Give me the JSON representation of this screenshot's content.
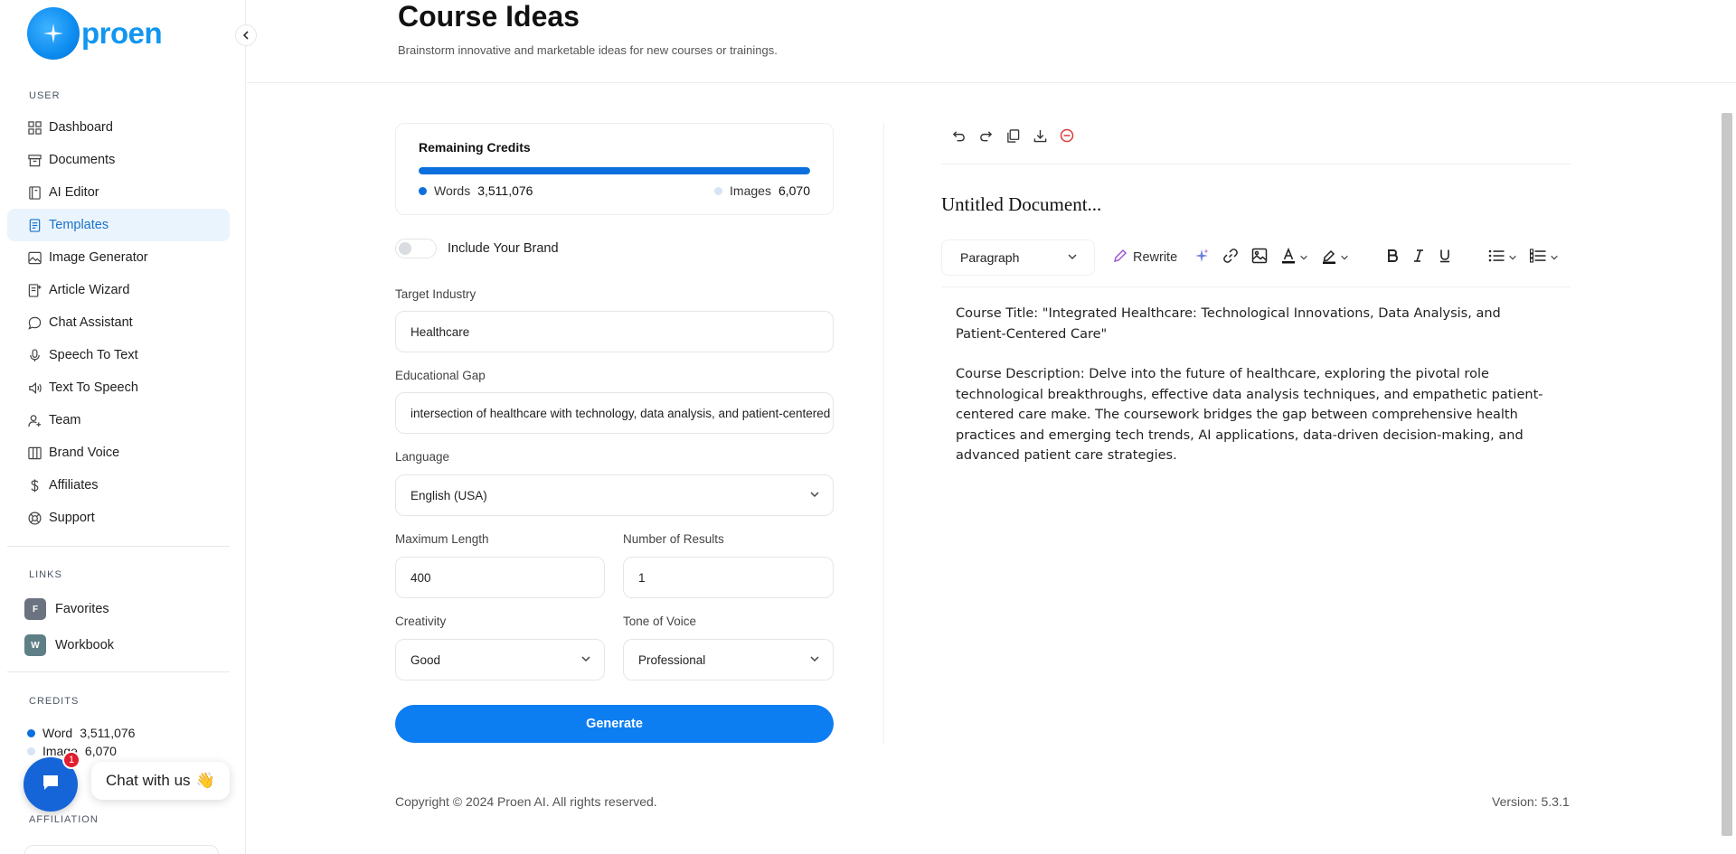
{
  "brand": {
    "name": "proen"
  },
  "sidebar": {
    "user_label": "USER",
    "items": [
      {
        "label": "Dashboard",
        "icon": "grid-icon"
      },
      {
        "label": "Documents",
        "icon": "archive-icon"
      },
      {
        "label": "AI Editor",
        "icon": "book-icon"
      },
      {
        "label": "Templates",
        "icon": "file-text-icon",
        "active": true
      },
      {
        "label": "Image Generator",
        "icon": "image-icon"
      },
      {
        "label": "Article Wizard",
        "icon": "wizard-doc-icon"
      },
      {
        "label": "Chat Assistant",
        "icon": "chat-icon"
      },
      {
        "label": "Speech To Text",
        "icon": "microphone-icon"
      },
      {
        "label": "Text To Speech",
        "icon": "speaker-icon"
      },
      {
        "label": "Team",
        "icon": "user-plus-icon"
      },
      {
        "label": "Brand Voice",
        "icon": "layout-icon"
      },
      {
        "label": "Affiliates",
        "icon": "dollar-icon"
      },
      {
        "label": "Support",
        "icon": "lifebuoy-icon"
      }
    ],
    "links_label": "LINKS",
    "links": [
      {
        "badge": "F",
        "label": "Favorites",
        "color": "#6b7280"
      },
      {
        "badge": "W",
        "label": "Workbook",
        "color": "#5f7f86"
      }
    ],
    "credits_label": "CREDITS",
    "credits": {
      "word_label": "Word",
      "word_value": "3,511,076",
      "image_label": "Image",
      "image_value": "6,070"
    },
    "affiliation_label": "AFFILIATION"
  },
  "chat": {
    "badge": "1",
    "label": "Chat with us",
    "wave": "👋"
  },
  "header": {
    "title": "Course Ideas",
    "subtitle": "Brainstorm innovative and marketable ideas for new courses or trainings."
  },
  "form": {
    "credits_title": "Remaining Credits",
    "words_label": "Words",
    "words_value": "3,511,076",
    "images_label": "Images",
    "images_value": "6,070",
    "words_progress": 1.0,
    "brand_toggle_label": "Include Your Brand",
    "target_industry_label": "Target Industry",
    "target_industry_value": "Healthcare",
    "educational_gap_label": "Educational Gap",
    "educational_gap_value": "intersection of healthcare with technology, data analysis, and patient-centered care",
    "language_label": "Language",
    "language_value": "English (USA)",
    "max_length_label": "Maximum Length",
    "max_length_value": "400",
    "num_results_label": "Number of Results",
    "num_results_value": "1",
    "creativity_label": "Creativity",
    "creativity_value": "Good",
    "tone_label": "Tone of Voice",
    "tone_value": "Professional",
    "generate_label": "Generate"
  },
  "editor": {
    "doc_title": "Untitled Document...",
    "block_type": "Paragraph",
    "rewrite_label": "Rewrite",
    "paragraphs": [
      "Course Title: \"Integrated Healthcare: Technological Innovations, Data Analysis, and Patient-Centered Care\"",
      "Course Description: Delve into the future of healthcare, exploring the pivotal role technological breakthroughs, effective data analysis techniques, and empathetic patient-centered care make. The coursework bridges the gap between comprehensive health practices and emerging tech trends, AI applications, data-driven decision-making, and advanced patient care strategies."
    ]
  },
  "footer": {
    "copyright": "Copyright © 2024 Proen AI. All rights reserved.",
    "version": "Version: 5.3.1"
  },
  "colors": {
    "primary": "#0d7ef2",
    "active_bg": "#eaf4fd",
    "brand_text": "#1296f0",
    "badge_red": "#e11d2e"
  }
}
